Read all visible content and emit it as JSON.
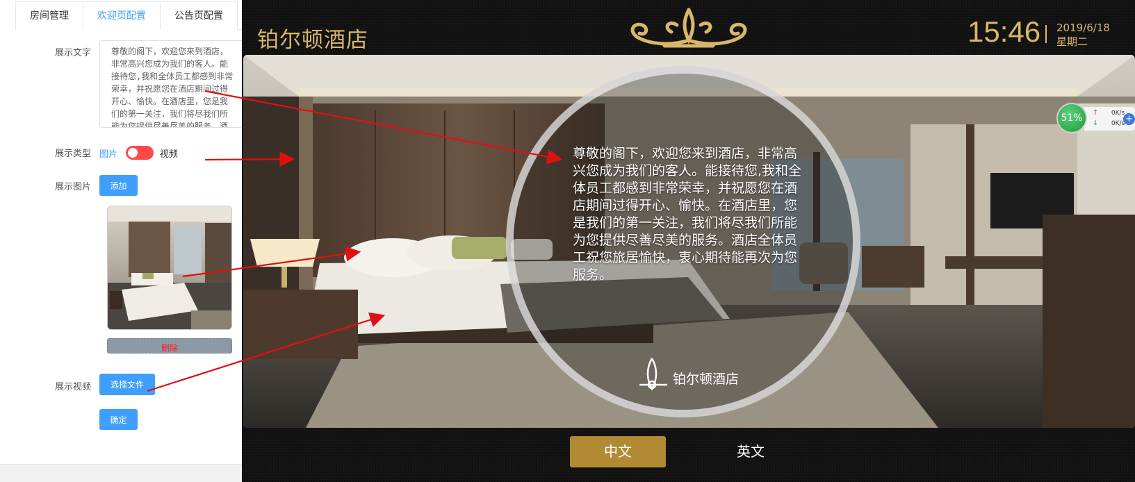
{
  "admin": {
    "tabs": [
      {
        "label": "房间管理",
        "active": false
      },
      {
        "label": "欢迎页配置",
        "active": true
      },
      {
        "label": "公告页配置",
        "active": false
      }
    ],
    "text_label": "展示文字",
    "text_value": "尊敬的阁下，欢迎您来到酒店，非常高兴您成为我们的客人。能接待您,我和全体员工都感到非常荣幸，并祝愿您在酒店期间过得开心、愉快。在酒店里，您是我们的第一关注，我们将尽我们所能为您提供尽善尽美的服务。酒店全体员工祝您旅居愉快，衷心期待能再次为您服务。",
    "type_label": "展示类型",
    "type_image": "图片",
    "type_video": "视频",
    "image_label": "展示图片",
    "add_button": "添加",
    "delete_button": "删除",
    "video_label": "展示视频",
    "choose_file_button": "选择文件",
    "confirm_button": "确定",
    "colors": {
      "accent": "#409eff",
      "switch": "#ff4949"
    }
  },
  "preview": {
    "hotel_name": "铂尔顿酒店",
    "time": "15:46",
    "date": "2019/6/18",
    "weekday": "星期二",
    "welcome_text": "尊敬的阁下，欢迎您来到酒店，非常高兴您成为我们的客人。能接待您,我和全体员工都感到非常荣幸，并祝愿您在酒店期间过得开心、愉快。在酒店里，您是我们的第一关注，我们将尽我们所能为您提供尽善尽美的服务。酒店全体员工祝您旅居愉快，衷心期待能再次为您服务。",
    "logo_text": "铂尔顿酒店",
    "lang_cn": "中文",
    "lang_en": "英文",
    "colors": {
      "gold": "#d9b76a",
      "button_gold": "#b38a34"
    }
  },
  "net_widget": {
    "percent": "51%",
    "upload": "0K/s",
    "download": "0K/s"
  }
}
